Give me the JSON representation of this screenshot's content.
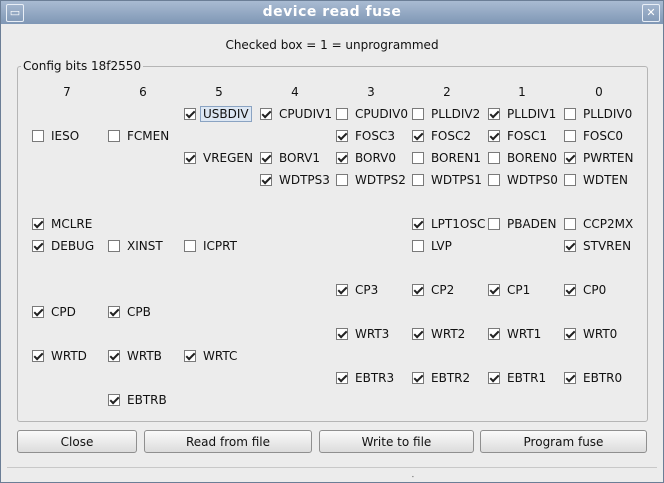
{
  "window": {
    "title": "device read fuse",
    "menu_icon": "window-menu-icon",
    "close_icon": "close-icon"
  },
  "info_text": "Checked box = 1 = unprogrammed",
  "group_label": "Config bits 18f2550",
  "column_headers": [
    "7",
    "6",
    "5",
    "4",
    "3",
    "2",
    "1",
    "0"
  ],
  "bits": [
    {
      "label": "USBDIV",
      "checked": true
    },
    {
      "label": "CPUDIV1",
      "checked": true
    },
    {
      "label": "CPUDIV0",
      "checked": false
    },
    {
      "label": "PLLDIV2",
      "checked": false
    },
    {
      "label": "PLLDIV1",
      "checked": true
    },
    {
      "label": "PLLDIV0",
      "checked": false
    },
    {
      "label": "IESO",
      "checked": false
    },
    {
      "label": "FCMEN",
      "checked": false
    },
    {
      "label": "FOSC3",
      "checked": true
    },
    {
      "label": "FOSC2",
      "checked": true
    },
    {
      "label": "FOSC1",
      "checked": true
    },
    {
      "label": "FOSC0",
      "checked": false
    },
    {
      "label": "VREGEN",
      "checked": true
    },
    {
      "label": "BORV1",
      "checked": true
    },
    {
      "label": "BORV0",
      "checked": true
    },
    {
      "label": "BOREN1",
      "checked": false
    },
    {
      "label": "BOREN0",
      "checked": false
    },
    {
      "label": "PWRTEN",
      "checked": true
    },
    {
      "label": "WDTPS3",
      "checked": true
    },
    {
      "label": "WDTPS2",
      "checked": false
    },
    {
      "label": "WDTPS1",
      "checked": false
    },
    {
      "label": "WDTPS0",
      "checked": false
    },
    {
      "label": "WDTEN",
      "checked": false
    },
    {
      "label": "MCLRE",
      "checked": true
    },
    {
      "label": "LPT1OSC",
      "checked": true
    },
    {
      "label": "PBADEN",
      "checked": false
    },
    {
      "label": "CCP2MX",
      "checked": false
    },
    {
      "label": "DEBUG",
      "checked": true
    },
    {
      "label": "XINST",
      "checked": false
    },
    {
      "label": "ICPRT",
      "checked": false
    },
    {
      "label": "LVP",
      "checked": false
    },
    {
      "label": "STVREN",
      "checked": true
    },
    {
      "label": "CP3",
      "checked": true
    },
    {
      "label": "CP2",
      "checked": true
    },
    {
      "label": "CP1",
      "checked": true
    },
    {
      "label": "CP0",
      "checked": true
    },
    {
      "label": "CPD",
      "checked": true
    },
    {
      "label": "CPB",
      "checked": true
    },
    {
      "label": "WRT3",
      "checked": true
    },
    {
      "label": "WRT2",
      "checked": true
    },
    {
      "label": "WRT1",
      "checked": true
    },
    {
      "label": "WRT0",
      "checked": true
    },
    {
      "label": "WRTD",
      "checked": true
    },
    {
      "label": "WRTB",
      "checked": true
    },
    {
      "label": "WRTC",
      "checked": true
    },
    {
      "label": "EBTR3",
      "checked": true
    },
    {
      "label": "EBTR2",
      "checked": true
    },
    {
      "label": "EBTR1",
      "checked": true
    },
    {
      "label": "EBTR0",
      "checked": true
    },
    {
      "label": "EBTRB",
      "checked": true
    }
  ],
  "buttons": {
    "close": "Close",
    "read": "Read from file",
    "write": "Write to file",
    "program": "Program fuse"
  }
}
